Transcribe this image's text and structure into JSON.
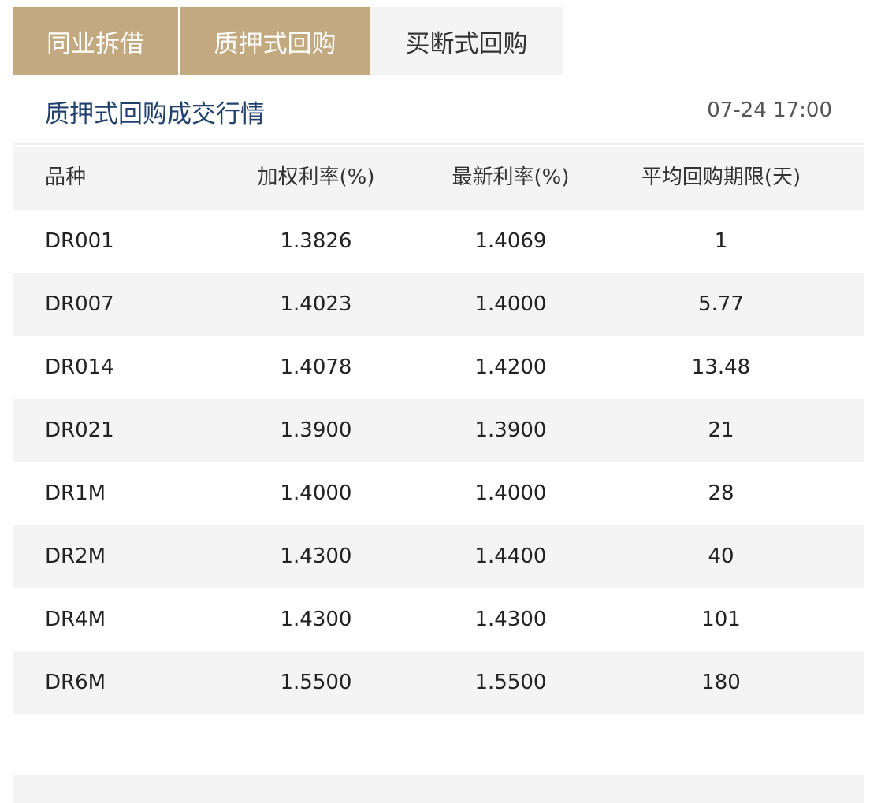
{
  "tabs": [
    {
      "label": "同业拆借"
    },
    {
      "label": "质押式回购"
    },
    {
      "label": "买断式回购"
    }
  ],
  "header": {
    "title": "质押式回购成交行情",
    "timestamp": "07-24 17:00"
  },
  "table": {
    "columns": [
      "品种",
      "加权利率(%)",
      "最新利率(%)",
      "平均回购期限(天)"
    ],
    "rows": [
      [
        "DR001",
        "1.3826",
        "1.4069",
        "1"
      ],
      [
        "DR007",
        "1.4023",
        "1.4000",
        "5.77"
      ],
      [
        "DR014",
        "1.4078",
        "1.4200",
        "13.48"
      ],
      [
        "DR021",
        "1.3900",
        "1.3900",
        "21"
      ],
      [
        "DR1M",
        "1.4000",
        "1.4000",
        "28"
      ],
      [
        "DR2M",
        "1.4300",
        "1.4400",
        "40"
      ],
      [
        "DR4M",
        "1.4300",
        "1.4300",
        "101"
      ],
      [
        "DR6M",
        "1.5500",
        "1.5500",
        "180"
      ]
    ]
  },
  "colors": {
    "active_tab": "#c3a97f",
    "inactive_tab": "#f4f4f4",
    "title": "#20406e",
    "row_shade": "#f4f4f4"
  }
}
